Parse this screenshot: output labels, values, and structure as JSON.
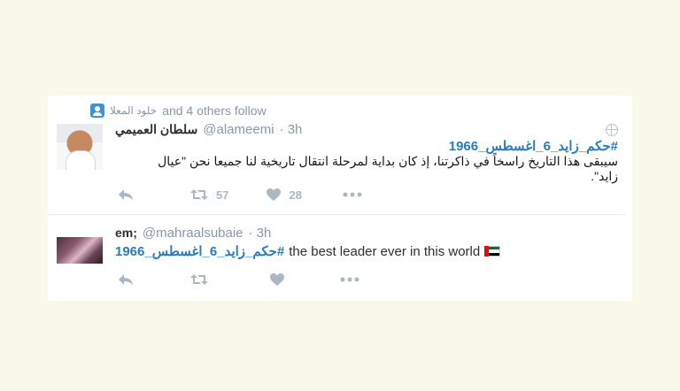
{
  "tweets": [
    {
      "context_names": "خلود المعلا",
      "context_text": "and 4 others follow",
      "name": "سلطان العميمي",
      "handle": "@alameemi",
      "time": "· 3h",
      "hashtag": "#حكم_زايد_6_اغسطس_1966",
      "text": "سيبقى هذا التاريخ راسخاً في ذاكرتنا، إذ كان بداية لمرحلة انتقال تاريخية لنا جميعا نحن \"عيال زايد\".",
      "retweets": "57",
      "likes": "28"
    },
    {
      "name": "em;",
      "handle": "@mahraalsubaie",
      "time": "· 3h",
      "hashtag": "#حكم_زايد_6_اغسطس_1966",
      "text": "the best leader ever in this world"
    }
  ],
  "icons": {
    "follow": "person-icon",
    "globe": "globe-icon",
    "reply": "reply-icon",
    "retweet": "retweet-icon",
    "like": "heart-icon",
    "more": "more-icon",
    "flag": "uae-flag-icon"
  },
  "colors": {
    "background": "#f9f9e9",
    "link": "#2b7bb9",
    "muted": "#aab8c2"
  }
}
